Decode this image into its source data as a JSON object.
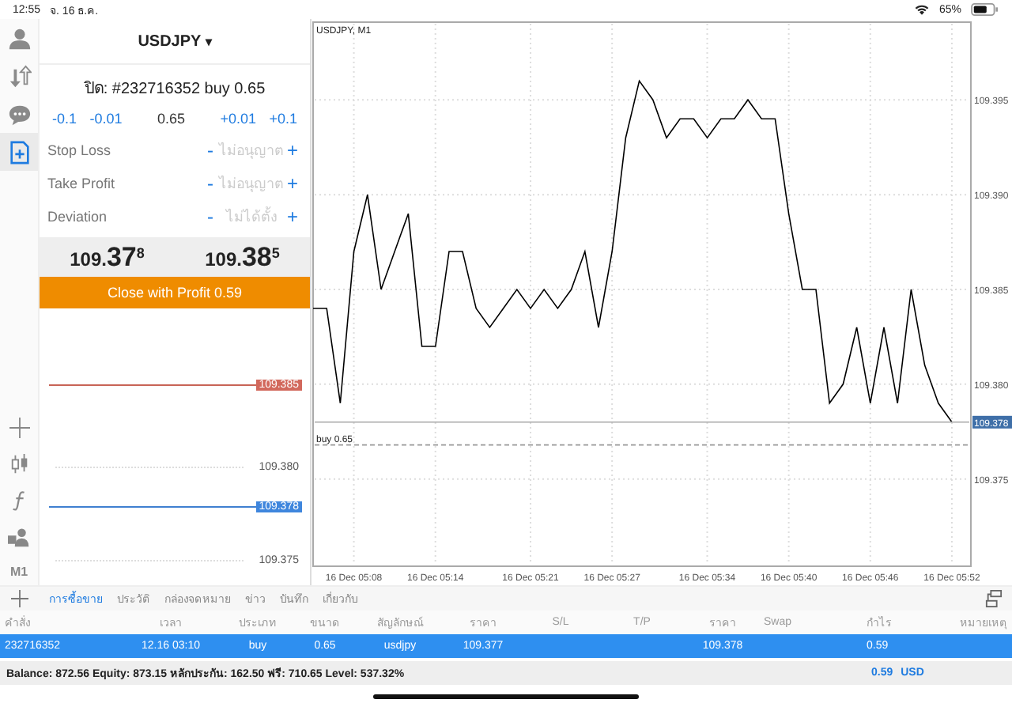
{
  "status_bar": {
    "time": "12:55",
    "date": "จ. 16 ธ.ค.",
    "battery": "65%"
  },
  "sidebar": {
    "top": [
      {
        "kind": "account",
        "selected": false
      },
      {
        "kind": "transfer",
        "selected": false
      },
      {
        "kind": "chat",
        "selected": false
      },
      {
        "kind": "new-order",
        "selected": true
      }
    ],
    "tools": [
      {
        "kind": "crosshair"
      },
      {
        "kind": "candles"
      },
      {
        "kind": "function"
      },
      {
        "kind": "objects"
      }
    ],
    "timeframe": "M1"
  },
  "order_panel": {
    "symbol": "USDJPY",
    "caret": "▾",
    "subtitle": "ปิด: #232716352 buy 0.65",
    "volume_steps": [
      {
        "label": "-0.1",
        "kind": "step"
      },
      {
        "label": "-0.01",
        "kind": "step"
      },
      {
        "label": "0.65",
        "kind": "value"
      },
      {
        "label": "+0.01",
        "kind": "step"
      },
      {
        "label": "+0.1",
        "kind": "step"
      }
    ],
    "fields": [
      {
        "label": "Stop Loss",
        "minus": "-",
        "value": "ไม่อนุญาต",
        "plus": "+"
      },
      {
        "label": "Take Profit",
        "minus": "-",
        "value": "ไม่อนุญาต",
        "plus": "+"
      },
      {
        "label": "Deviation",
        "minus": "-",
        "value": "ไม่ได้ตั้ง",
        "plus": "+"
      }
    ],
    "prices": [
      {
        "prefix": "109.",
        "big": "37",
        "sup": "8"
      },
      {
        "prefix": "109.",
        "big": "38",
        "sup": "5"
      }
    ],
    "close_button": "Close with Profit 0.59",
    "levels": [
      {
        "label": "109.385",
        "kind": "ask"
      },
      {
        "label": "109.380",
        "kind": "grid"
      },
      {
        "label": "109.378",
        "kind": "bid"
      },
      {
        "label": "109.375",
        "kind": "grid"
      }
    ]
  },
  "chart": {
    "chart_data": {
      "type": "line",
      "title": "USDJPY, M1",
      "categories": [
        null,
        null,
        null,
        "16 Dec 05:08",
        null,
        null,
        null,
        null,
        null,
        "16 Dec 05:14",
        null,
        null,
        null,
        null,
        null,
        null,
        "16 Dec 05:21",
        null,
        null,
        null,
        null,
        null,
        "16 Dec 05:27",
        null,
        null,
        null,
        null,
        null,
        null,
        "16 Dec 05:34",
        null,
        null,
        null,
        null,
        null,
        "16 Dec 05:40",
        null,
        null,
        null,
        null,
        null,
        "16 Dec 05:46",
        null,
        null,
        null,
        null,
        null,
        "16 Dec 05:52"
      ],
      "series": [
        {
          "color": "#000000",
          "values": [
            109.384,
            109.384,
            109.379,
            109.387,
            109.39,
            109.385,
            109.387,
            109.389,
            109.382,
            109.382,
            109.387,
            109.387,
            109.384,
            109.383,
            109.384,
            109.385,
            109.384,
            109.385,
            109.384,
            109.385,
            109.387,
            109.383,
            109.387,
            109.393,
            109.396,
            109.395,
            109.393,
            109.394,
            109.394,
            109.393,
            109.394,
            109.394,
            109.395,
            109.394,
            109.394,
            109.389,
            109.385,
            109.385,
            109.379,
            109.38,
            109.383,
            109.379,
            109.383,
            109.379,
            109.385,
            109.381,
            109.379,
            109.378
          ]
        }
      ],
      "ylim": [
        109.3704,
        109.3991
      ],
      "yticks": [
        {
          "value": 109.375,
          "label": "109.375"
        },
        {
          "value": 109.38,
          "label": "109.380"
        },
        {
          "value": 109.385,
          "label": "109.385"
        },
        {
          "value": 109.39,
          "label": "109.390"
        },
        {
          "value": 109.395,
          "label": "109.395"
        }
      ],
      "grid": true,
      "ref_lines": [
        {
          "axis": "y",
          "value": 109.378,
          "label": "109.378"
        },
        {
          "axis": "y",
          "value": 109.3768,
          "label": "buy 0.65"
        }
      ]
    }
  },
  "bottom": {
    "tabs": [
      {
        "label": "การซื้อขาย",
        "selected": true
      },
      {
        "label": "ประวัติ",
        "selected": false
      },
      {
        "label": "กล่องจดหมาย",
        "selected": false
      },
      {
        "label": "ข่าว",
        "selected": false
      },
      {
        "label": "บันทึก",
        "selected": false
      },
      {
        "label": "เกี่ยวกับ",
        "selected": false
      }
    ],
    "table": {
      "columns": [
        "คำสั่ง",
        "เวลา",
        "ประเภท",
        "ขนาด",
        "สัญลักษณ์",
        "ราคา",
        "S/L",
        "T/P",
        "ราคา",
        "Swap",
        "กำไร",
        "หมายเหตุ"
      ],
      "rows": [
        {
          "selected": true,
          "cells": [
            "232716352",
            "12.16 03:10",
            "buy",
            "0.65",
            "usdjpy",
            "109.377",
            null,
            null,
            "109.378",
            null,
            "0.59",
            null
          ]
        }
      ]
    },
    "summary": {
      "text": "Balance: 872.56 Equity: 873.15 หลักประกัน: 162.50 ฟรี: 710.65 Level: 537.32%",
      "profit": "0.59",
      "currency": "USD"
    }
  }
}
